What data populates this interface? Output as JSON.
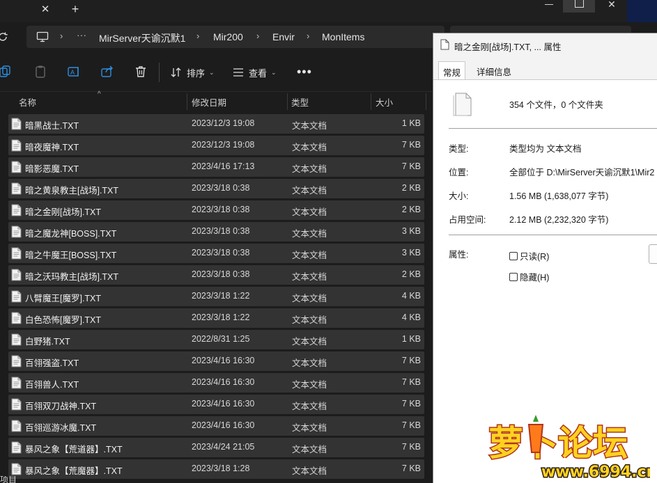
{
  "explorer": {
    "address": {
      "crumbs": [
        "MirServer天谕沉默1",
        "Mir200",
        "Envir",
        "MonItems"
      ]
    },
    "toolbar": {
      "sort_label": "排序",
      "view_label": "查看"
    },
    "columns": {
      "name": "名称",
      "date": "修改日期",
      "type": "类型",
      "size": "大小"
    },
    "files": [
      {
        "name": "暗黑战士.TXT",
        "date": "2023/12/3 19:08",
        "type": "文本文档",
        "size": "1 KB"
      },
      {
        "name": "暗夜魔神.TXT",
        "date": "2023/12/3 19:08",
        "type": "文本文档",
        "size": "7 KB"
      },
      {
        "name": "暗影恶魔.TXT",
        "date": "2023/4/16 17:13",
        "type": "文本文档",
        "size": "7 KB"
      },
      {
        "name": "暗之黄泉教主[战场].TXT",
        "date": "2023/3/18 0:38",
        "type": "文本文档",
        "size": "2 KB"
      },
      {
        "name": "暗之金刚[战场].TXT",
        "date": "2023/3/18 0:38",
        "type": "文本文档",
        "size": "2 KB"
      },
      {
        "name": "暗之魔龙神[BOSS].TXT",
        "date": "2023/3/18 0:38",
        "type": "文本文档",
        "size": "3 KB"
      },
      {
        "name": "暗之牛魔王[BOSS].TXT",
        "date": "2023/3/18 0:38",
        "type": "文本文档",
        "size": "3 KB"
      },
      {
        "name": "暗之沃玛教主[战场].TXT",
        "date": "2023/3/18 0:38",
        "type": "文本文档",
        "size": "2 KB"
      },
      {
        "name": "八臂魔王[魔罗].TXT",
        "date": "2023/3/18 1:22",
        "type": "文本文档",
        "size": "4 KB"
      },
      {
        "name": "白色恐怖[魔罗].TXT",
        "date": "2023/3/18 1:22",
        "type": "文本文档",
        "size": "4 KB"
      },
      {
        "name": "白野猪.TXT",
        "date": "2022/8/31 1:25",
        "type": "文本文档",
        "size": "1 KB"
      },
      {
        "name": "百翎强盗.TXT",
        "date": "2023/4/16 16:30",
        "type": "文本文档",
        "size": "7 KB"
      },
      {
        "name": "百翎兽人.TXT",
        "date": "2023/4/16 16:30",
        "type": "文本文档",
        "size": "7 KB"
      },
      {
        "name": "百翎双刀战神.TXT",
        "date": "2023/4/16 16:30",
        "type": "文本文档",
        "size": "7 KB"
      },
      {
        "name": "百翎巡游冰魔.TXT",
        "date": "2023/4/16 16:30",
        "type": "文本文档",
        "size": "7 KB"
      },
      {
        "name": "暴风之象【荒道器】.TXT",
        "date": "2023/4/24 21:05",
        "type": "文本文档",
        "size": "7 KB"
      },
      {
        "name": "暴风之象【荒魔器】.TXT",
        "date": "2023/3/18 1:28",
        "type": "文本文档",
        "size": "7 KB"
      }
    ],
    "status_text": "项目"
  },
  "properties": {
    "title": "暗之金刚[战场].TXT, ... 属性",
    "tabs": [
      "常规",
      "详细信息"
    ],
    "file_count": "354 个文件，0 个文件夹",
    "type_label": "类型:",
    "type_value": "类型均为 文本文档",
    "location_label": "位置:",
    "location_value": "全部位于 D:\\MirServer天谕沉默1\\Mir2",
    "size_label": "大小:",
    "size_value": "1.56 MB (1,638,077 字节)",
    "disk_label": "占用空间:",
    "disk_value": "2.12 MB (2,232,320 字节)",
    "attr_label": "属性:",
    "readonly_label": "只读(R)",
    "hidden_label": "隐藏(H)"
  },
  "watermark": {
    "brand": "萝卜论坛",
    "url": "www.6994.cn"
  },
  "colors": {
    "explorer_bg": "#1c1c1c",
    "row_bg": "#333333",
    "dialog_bg": "#ffffff",
    "watermark_yellow": "#ffd21f",
    "watermark_orange": "#ff7a1a"
  }
}
